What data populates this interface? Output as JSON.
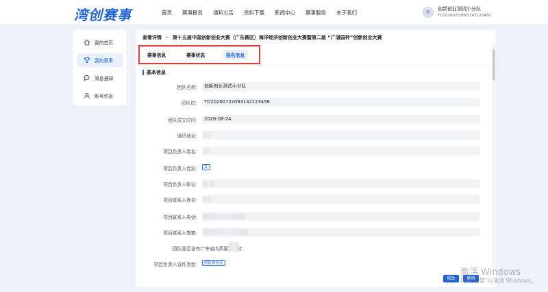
{
  "header": {
    "logo": "湾创赛事",
    "nav": [
      "首页",
      "赛事报名",
      "通知公告",
      "资料下载",
      "新闻中心",
      "赛事服务",
      "关于我们"
    ],
    "user_name": "创新创业测试小分队",
    "user_id": "TD20260722093142123456"
  },
  "sidebar": {
    "items": [
      {
        "label": "我的首页",
        "icon": "home-icon"
      },
      {
        "label": "我的赛事",
        "icon": "trophy-icon"
      },
      {
        "label": "消息通知",
        "icon": "message-icon"
      },
      {
        "label": "账号信息",
        "icon": "user-icon"
      }
    ]
  },
  "main": {
    "breadcrumb_root": "查看详情",
    "breadcrumb_sep": ">",
    "breadcrumb_title": "第十五届中国创新创业大赛（广东赛区）海洋经济创新创业大赛暨第二届 “广湛园杯”创新创业大赛",
    "tabs": [
      "赛事信息",
      "赛事状态",
      "报名信息"
    ],
    "section_title": "基本信息",
    "fields": [
      {
        "label": "团队名称:",
        "value": "创新创业测试小分队"
      },
      {
        "label": "团队ID:",
        "value": "TD20260722093142123456"
      },
      {
        "label": "团队成立时间:",
        "value": "2026-08-24"
      },
      {
        "label": "通讯地址:",
        "value": ""
      },
      {
        "label": "项目负责人姓名:",
        "value": ""
      },
      {
        "label": "项目负责人性别:",
        "value": "女"
      },
      {
        "label": "项目负责人职位:",
        "value": ""
      },
      {
        "label": "项目联系人姓名:",
        "value": ""
      },
      {
        "label": "项目联系人电话:",
        "value": ""
      },
      {
        "label": "项目联系人邮箱:",
        "value": ""
      },
      {
        "label": "团队是否含有广东省内高层次人才:",
        "value": ""
      },
      {
        "label": "项目负责人证件类型:",
        "value": "居民身份证"
      }
    ],
    "buttons": {
      "edit": "修改",
      "cancel": "撤销"
    }
  },
  "watermark": {
    "line1": "激活 Windows",
    "line2": "转到“设置”以激活 Windows。"
  }
}
